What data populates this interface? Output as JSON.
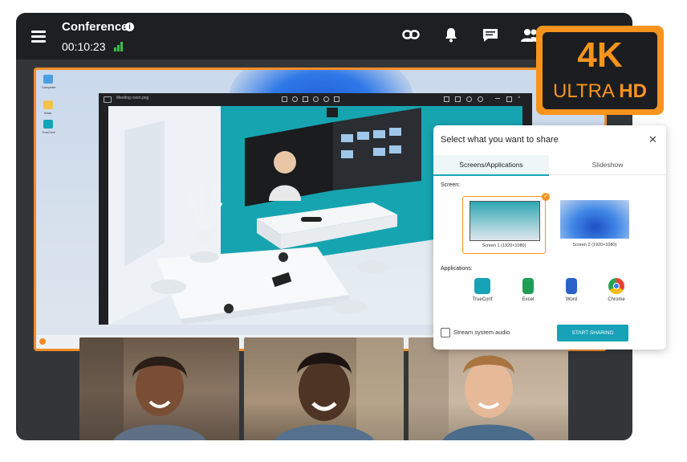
{
  "header": {
    "conference_title": "Conference",
    "timer": "00:10:23",
    "icons": [
      "menu-icon",
      "info-icon",
      "signal-icon",
      "link-icon",
      "bell-icon",
      "chat-icon",
      "participants-icon"
    ]
  },
  "badge": {
    "big": "4K",
    "line_a": "ULTRA ",
    "line_b": "HD"
  },
  "share_dialog": {
    "title": "Select what you want to share",
    "tabs": [
      "Screens/Applications",
      "Slideshow"
    ],
    "screen_label": "Screen:",
    "screens": [
      {
        "label": "Screen 1 (1920×1080)",
        "selected": true
      },
      {
        "label": "Screen 2 (1920×1080)",
        "selected": false
      }
    ],
    "applications_label": "Applications:",
    "applications": [
      {
        "label": "TrueConf",
        "icon": "trueconf-icon",
        "color": "#16a3b5"
      },
      {
        "label": "Excel",
        "icon": "excel-icon",
        "color": "#1f9d55"
      },
      {
        "label": "Word",
        "icon": "word-icon",
        "color": "#2b62c9"
      },
      {
        "label": "Chrome",
        "icon": "chrome-icon",
        "color": "#e5432f"
      }
    ],
    "stream_audio_label": "Stream system audio",
    "start_button": "START SHARING"
  },
  "shared_screen": {
    "viewer_title": "Meeting room.png",
    "desktop_labels": [
      "Computer",
      "Work",
      "TrueConf"
    ]
  },
  "colors": {
    "accent": "#17a2b8",
    "orange": "#f6941e",
    "signal": "#3bbf4a",
    "topbar": "#1d1f21"
  }
}
